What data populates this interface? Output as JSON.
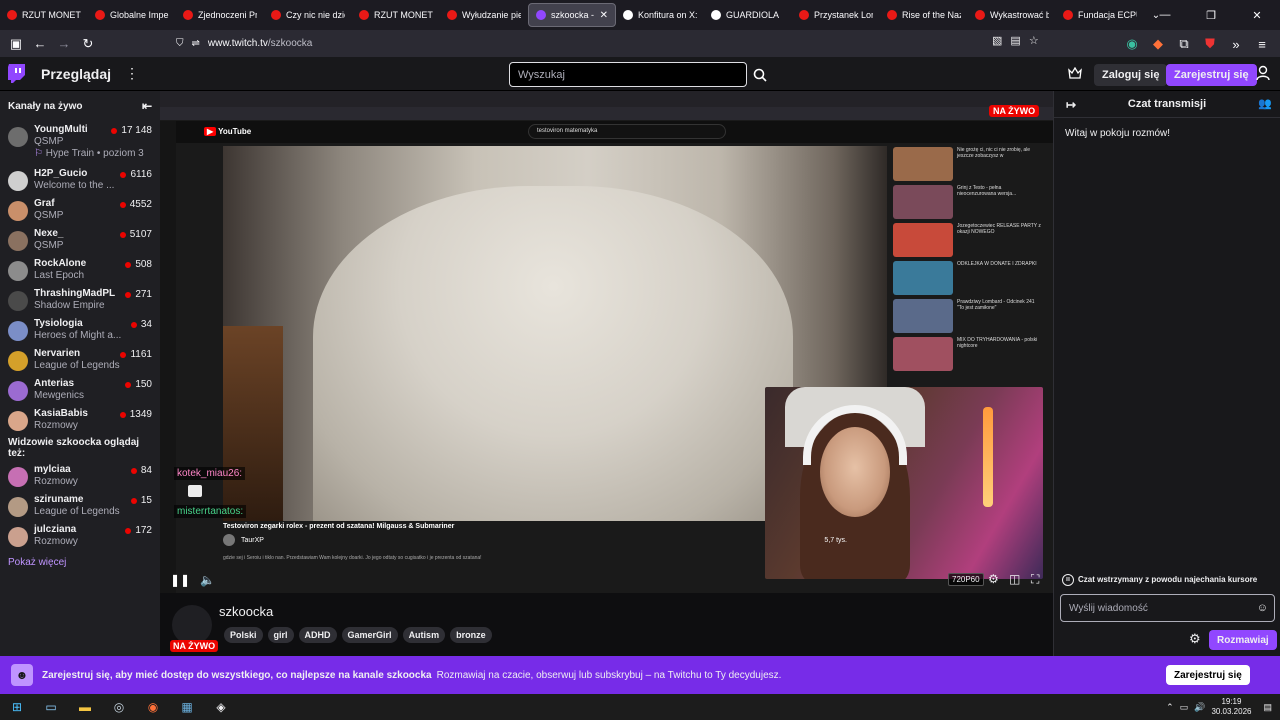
{
  "browser": {
    "tabs": [
      {
        "label": "RZUT MONETĄ I",
        "color": "#e91916"
      },
      {
        "label": "Globalne Imperi",
        "color": "#e91916"
      },
      {
        "label": "Zjednoczeni Prze",
        "color": "#e91916"
      },
      {
        "label": "Czy nic nie dziej",
        "color": "#e91916"
      },
      {
        "label": "RZUT MONETĄ I",
        "color": "#e91916"
      },
      {
        "label": "Wyłudzanie pien",
        "color": "#e91916"
      },
      {
        "label": "szkoocka - Tw",
        "color": "#9147ff",
        "active": true
      },
      {
        "label": "Konfitura on X: \"",
        "color": "#ffffff"
      },
      {
        "label": "GUARDIOLA",
        "color": "#ffffff"
      },
      {
        "label": "Przystanek Lomb",
        "color": "#e91916"
      },
      {
        "label": "Rise of the Nazis",
        "color": "#e91916"
      },
      {
        "label": "Wykastrować bez",
        "color": "#e91916"
      },
      {
        "label": "Fundacja ECPU P",
        "color": "#e91916"
      }
    ],
    "url_host": "www.twitch.tv",
    "url_path": "/szkoocka"
  },
  "topbar": {
    "browse": "Przeglądaj",
    "search_placeholder": "Wyszukaj",
    "login": "Zaloguj się",
    "signup": "Zarejestruj się"
  },
  "sidebar": {
    "live_header": "Kanały na żywo",
    "channels": [
      {
        "name": "YoungMulti",
        "game": "QSMP",
        "viewers": "17 148",
        "hype": "Hype Train • poziom 3",
        "color": "#6d6d6d"
      },
      {
        "name": "H2P_Gucio",
        "game": "Welcome to the ...",
        "viewers": "6116",
        "color": "#cfcfcf"
      },
      {
        "name": "Graf",
        "game": "QSMP",
        "viewers": "4552",
        "color": "#c98f6a"
      },
      {
        "name": "Nexe_",
        "game": "QSMP",
        "viewers": "5107",
        "color": "#8a7160"
      },
      {
        "name": "RockAlone",
        "game": "Last Epoch",
        "viewers": "508",
        "color": "#8c8c8c"
      },
      {
        "name": "ThrashingMadPL",
        "game": "Shadow Empire",
        "viewers": "271",
        "color": "#4a4a4a"
      },
      {
        "name": "Tysiologia",
        "game": "Heroes of Might a...",
        "viewers": "34",
        "color": "#7b8ec7"
      },
      {
        "name": "Nervarien",
        "game": "League of Legends",
        "viewers": "1161",
        "color": "#d4a02a"
      },
      {
        "name": "Anterias",
        "game": "Mewgenics",
        "viewers": "150",
        "color": "#9b6bd1"
      },
      {
        "name": "KasiaBabis",
        "game": "Rozmowy",
        "viewers": "1349",
        "color": "#d9a68a"
      }
    ],
    "also_header": "Widzowie szkoocka oglądaj też:",
    "also": [
      {
        "name": "mylciaa",
        "game": "Rozmowy",
        "viewers": "84",
        "color": "#c66fb3"
      },
      {
        "name": "sziruname",
        "game": "League of Legends",
        "viewers": "15",
        "color": "#b39a84"
      },
      {
        "name": "julcziana",
        "game": "Rozmowy",
        "viewers": "172",
        "color": "#caa08e"
      }
    ],
    "show_more": "Pokaż więcej"
  },
  "video": {
    "live_badge": "NA ŻYWO",
    "yt_search": "testoviron matematyka",
    "yt_title": "Testoviron zegarki rolex - prezent od szatana! Milgauss & Submariner",
    "yt_channel": "TaurXP",
    "yt_desc": "gdzie sej i Seroiu i tiklo nan. Przedstawiam Wam kolejny doarki. Jo jego odtaty so cugisatko i je prezenta od szatana!",
    "yt_likes": "5,7 tys.",
    "chat_names": [
      "kotek_miau26:",
      "misterrtanatos:"
    ],
    "quality": "720P60",
    "recs": [
      {
        "title": "Nie grożę ci, nic ci nie zrobię, ale jeszcze zobaczysz w",
        "color": "#9a6a4a"
      },
      {
        "title": "Grinj z Testo - pełna nieocenzurowana wersja...",
        "color": "#7a4a5a"
      },
      {
        "title": "Jozegetoczewiec RELEASE PARTY z okazji NOWEGO",
        "color": "#c84a3a"
      },
      {
        "title": "ODKLEJKA W DONATE I ZDRAPKI",
        "color": "#3a7a9a"
      },
      {
        "title": "Prawdziwy Lombard - Odcinek 241 \"To jest zamiłone\"",
        "color": "#5a6a8a"
      },
      {
        "title": "MIX DO TRYHARDOWANIA - polski nightcore",
        "color": "#a05060"
      }
    ]
  },
  "channel": {
    "name": "szkoocka",
    "live": "NA ŻYWO",
    "tags": [
      "Polski",
      "girl",
      "ADHD",
      "GamerGirl",
      "Autism",
      "bronze"
    ]
  },
  "chat": {
    "title": "Czat transmisji",
    "welcome": "Witaj w pokoju rozmów!",
    "paused": "Czat wstrzymany z powodu najechania kursore",
    "placeholder": "Wyślij wiadomość",
    "send": "Rozmawiaj"
  },
  "banner": {
    "bold": "Zarejestruj się, aby mieć dostęp do wszystkiego, co najlepsze na kanale szkoocka",
    "text": "Rozmawiaj na czacie, obserwuj lub subskrybuj – na Twitchu to Ty decydujesz.",
    "button": "Zarejestruj się"
  },
  "taskbar": {
    "time": "19:19",
    "date": "30.03.2026"
  }
}
